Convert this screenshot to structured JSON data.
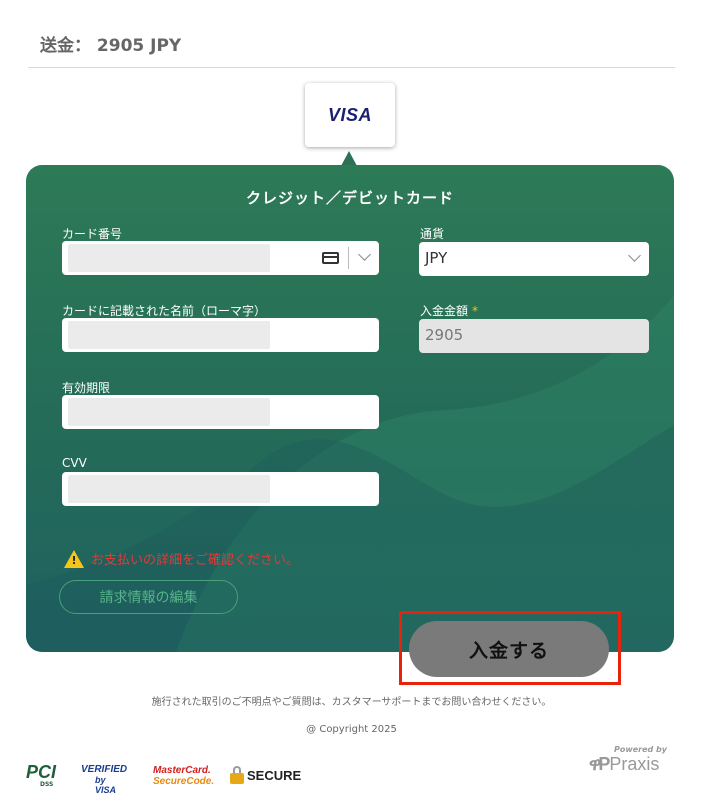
{
  "header": {
    "amount_text": "送金： 2905 JPY"
  },
  "card_brand": {
    "logo": "VISA",
    "color": "#1a1f71"
  },
  "form": {
    "title": "クレジット／デビットカード",
    "card_number_label": "カード番号",
    "card_icon": "credit-card-icon",
    "cardholder_label": "カードに記載された名前（ローマ字）",
    "expiry_label": "有効期限",
    "cvv_label": "CVV",
    "currency_label": "通貨",
    "currency_value": "JPY",
    "amount_label": "入金金額",
    "amount_required_mark": "*",
    "amount_value": "2905",
    "warning_icon": "warning-icon",
    "warning_text": "お支払いの詳細をご確認ください。",
    "edit_billing_label": "請求情報の編集",
    "panel_color": "#2d7a57"
  },
  "submit": {
    "label": "入金する",
    "highlight_color": "#e8230b"
  },
  "footer": {
    "notice": "施行された取引のご不明点やご質問は、カスタマーサポートまでお問い合わせください。",
    "copyright": "@ Copyright 2025",
    "badges": {
      "pci": "PCI",
      "pci_sub": "DSS",
      "vbv_line1": "VERIFIED",
      "vbv_line2": "by VISA",
      "mc_line1": "MasterCard.",
      "mc_line2": "SecureCode.",
      "secure": "SECURE"
    },
    "powered_by": "Powered by",
    "praxis_mark": "ዋP",
    "praxis": "Praxis"
  }
}
